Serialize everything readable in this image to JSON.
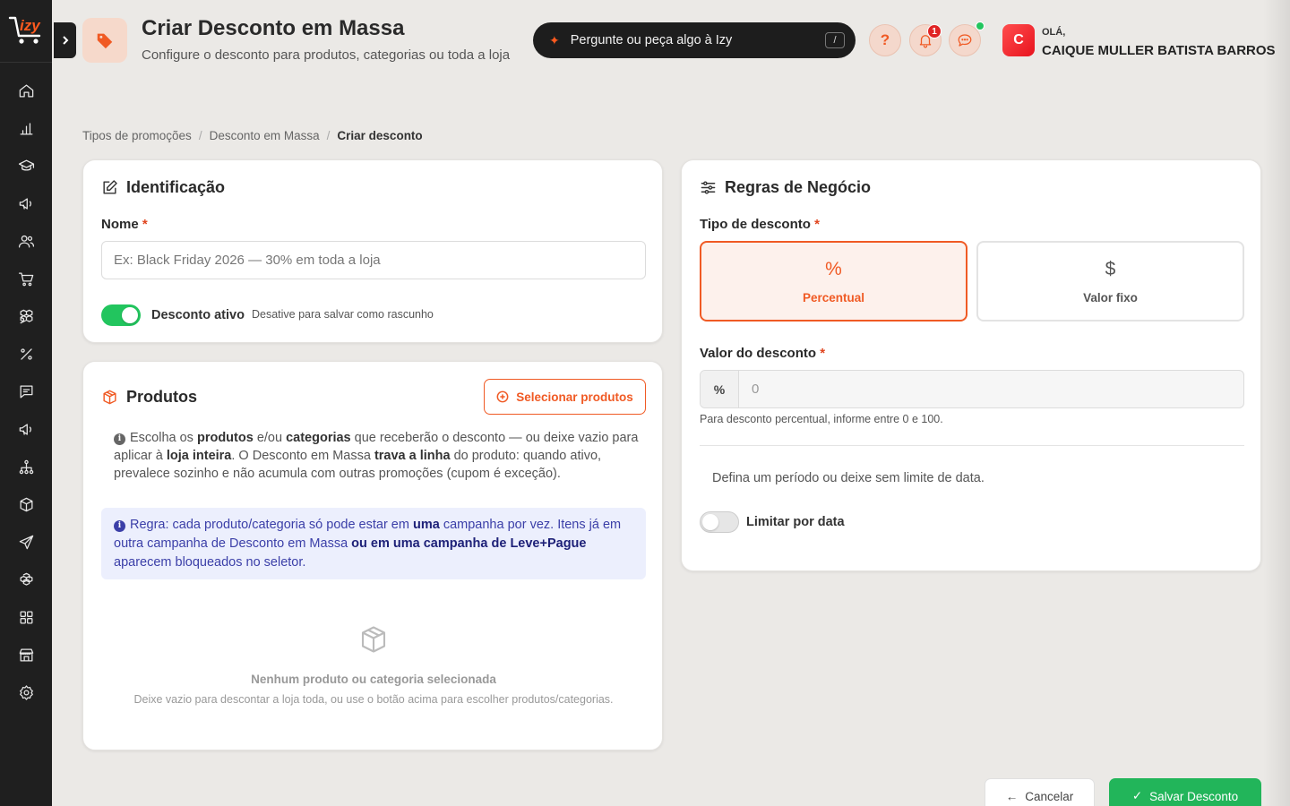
{
  "header": {
    "title": "Criar Desconto em Massa",
    "subtitle": "Configure o desconto para produtos, categorias ou toda a loja",
    "ask_izy_placeholder": "Pergunte ou peça algo à Izy",
    "ask_izy_shortcut": "/",
    "help_label": "?",
    "notification_count": "1",
    "greeting": "OLÁ,",
    "user_name": "CAIQUE MULLER BATISTA BARROS",
    "user_initial": "C"
  },
  "sidebar": {
    "items": [
      "home-icon",
      "bar-chart-icon",
      "graduation-cap-icon",
      "megaphone-icon",
      "users-icon",
      "shopping-cart-icon",
      "boxes-icon",
      "percent-icon",
      "message-square-icon",
      "megaphone-2-icon",
      "network-icon",
      "package-icon",
      "send-icon",
      "boxes-2-icon",
      "grid-icon",
      "store-icon",
      "settings-icon"
    ]
  },
  "breadcrumb": {
    "items": [
      "Tipos de promoções",
      "Desconto em Massa"
    ],
    "current": "Criar desconto"
  },
  "identificacao": {
    "title": "Identificação",
    "name_label": "Nome",
    "name_placeholder": "Ex: Black Friday 2026 — 30% em toda a loja",
    "active_label": "Desconto ativo",
    "active_hint": "Desative para salvar como rascunho",
    "active": true
  },
  "produtos": {
    "title": "Produtos",
    "select_button": "Selecionar produtos",
    "info_parts": [
      "Escolha os ",
      "produtos",
      " e/ou ",
      "categorias",
      " que receberão o desconto — ou deixe vazio para aplicar à ",
      "loja inteira",
      ". O Desconto em Massa ",
      "trava a linha",
      " do produto: quando ativo, prevalece sozinho e não acumula com outras promoções (cupom é exceção)."
    ],
    "rule_parts": [
      "Regra: cada produto/categoria só pode estar em ",
      "uma",
      " campanha por vez. Itens já em outra campanha de Desconto em Massa ",
      "ou em uma campanha de Leve+Pague",
      " aparecem bloqueados no seletor."
    ],
    "empty_title": "Nenhum produto ou categoria selecionada",
    "empty_subtitle": "Deixe vazio para descontar a loja toda, ou use o botão acima para escolher produtos/categorias."
  },
  "regras": {
    "title": "Regras de Negócio",
    "type_label": "Tipo de desconto",
    "type_options": [
      {
        "symbol": "%",
        "label": "Percentual",
        "selected": true
      },
      {
        "symbol": "$",
        "label": "Valor fixo",
        "selected": false
      }
    ],
    "value_label": "Valor do desconto",
    "value_addon": "%",
    "value_placeholder": "0",
    "value_hint": "Para desconto percentual, informe entre 0 e 100.",
    "period_text": "Defina um período ou deixe sem limite de data.",
    "date_limit_label": "Limitar por data",
    "date_limit": false
  },
  "footer": {
    "cancel_label": "Cancelar",
    "save_label": "Salvar Desconto"
  },
  "colors": {
    "accent": "#f05a24",
    "success": "#22c55e",
    "sidebar_bg": "#1f1f1f",
    "page_bg": "#ebe9e6"
  }
}
